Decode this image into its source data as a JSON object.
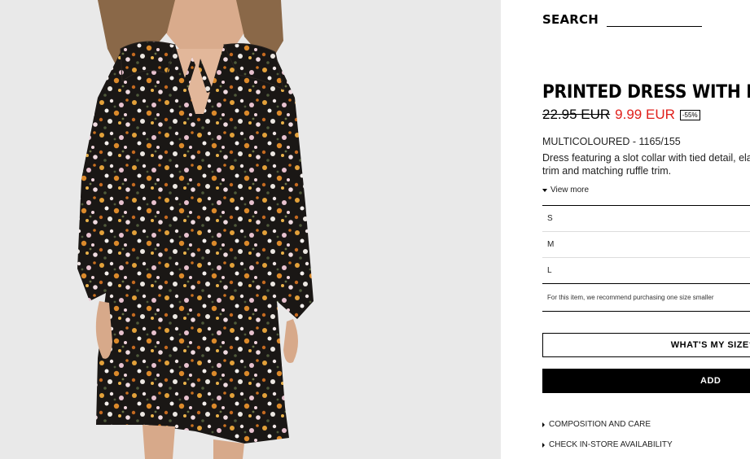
{
  "header": {
    "search_label": "SEARCH"
  },
  "product": {
    "title": "PRINTED DRESS WITH RUFFLES",
    "old_price": "22.95 EUR",
    "new_price": "9.99 EUR",
    "discount": "-55%",
    "color_ref": "MULTICOLOURED - 1165/155",
    "description": "Dress featuring a slot collar with tied detail, elastic trim and matching ruffle trim.",
    "view_more": "View more"
  },
  "sizes": [
    "S",
    "M",
    "L"
  ],
  "size_note": "For this item, we recommend purchasing one size smaller",
  "actions": {
    "whats_my_size": "WHAT'S MY SIZE?",
    "add": "ADD"
  },
  "links": {
    "composition": "COMPOSITION AND CARE",
    "store_availability": "CHECK IN-STORE AVAILABILITY"
  },
  "colors": {
    "sale_red": "#e0201b",
    "photo_background": "#e9e9e9"
  }
}
